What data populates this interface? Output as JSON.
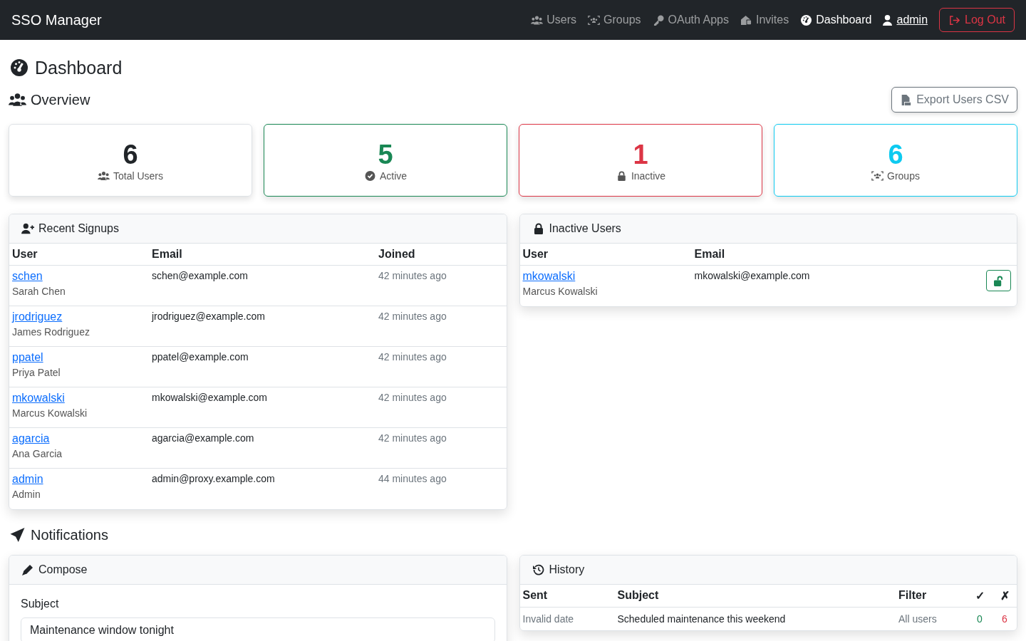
{
  "navbar": {
    "brand": "SSO Manager",
    "items": [
      {
        "label": "Users",
        "selected": false
      },
      {
        "label": "Groups",
        "selected": false
      },
      {
        "label": "OAuth Apps",
        "selected": false
      },
      {
        "label": "Invites",
        "selected": false
      },
      {
        "label": "Dashboard",
        "selected": true
      }
    ],
    "user": "admin",
    "logout": "Log Out"
  },
  "page_title": "Dashboard",
  "overview": {
    "title": "Overview",
    "export_button": "Export Users CSV",
    "stats": [
      {
        "value": "6",
        "label": "Total Users",
        "color": "#212529"
      },
      {
        "value": "5",
        "label": "Active",
        "color": "#198754"
      },
      {
        "value": "1",
        "label": "Inactive",
        "color": "#dc3545"
      },
      {
        "value": "6",
        "label": "Groups",
        "color": "#0dcaf0"
      }
    ]
  },
  "recent_signups": {
    "title": "Recent Signups",
    "columns": [
      "User",
      "Email",
      "Joined"
    ],
    "rows": [
      {
        "username": "schen",
        "name": "Sarah Chen",
        "email": "schen@example.com",
        "joined": "42 minutes ago"
      },
      {
        "username": "jrodriguez",
        "name": "James Rodriguez",
        "email": "jrodriguez@example.com",
        "joined": "42 minutes ago"
      },
      {
        "username": "ppatel",
        "name": "Priya Patel",
        "email": "ppatel@example.com",
        "joined": "42 minutes ago"
      },
      {
        "username": "mkowalski",
        "name": "Marcus Kowalski",
        "email": "mkowalski@example.com",
        "joined": "42 minutes ago"
      },
      {
        "username": "agarcia",
        "name": "Ana Garcia",
        "email": "agarcia@example.com",
        "joined": "42 minutes ago"
      },
      {
        "username": "admin",
        "name": "Admin",
        "email": "admin@proxy.example.com",
        "joined": "44 minutes ago"
      }
    ]
  },
  "inactive_users": {
    "title": "Inactive Users",
    "columns": [
      "User",
      "Email"
    ],
    "rows": [
      {
        "username": "mkowalski",
        "name": "Marcus Kowalski",
        "email": "mkowalski@example.com"
      }
    ]
  },
  "notifications": {
    "title": "Notifications",
    "compose": {
      "title": "Compose",
      "subject_label": "Subject",
      "subject_value": "Maintenance window tonight"
    },
    "history": {
      "title": "History",
      "columns": [
        "Sent",
        "Subject",
        "Filter",
        "✓",
        "✗"
      ],
      "rows": [
        {
          "sent": "Invalid date",
          "subject": "Scheduled maintenance this weekend",
          "filter": "All users",
          "ok": "0",
          "failed": "6"
        }
      ]
    }
  }
}
